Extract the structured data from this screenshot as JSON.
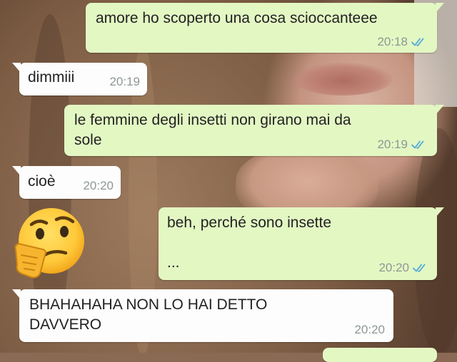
{
  "chat": {
    "messages": [
      {
        "direction": "outgoing",
        "text": "amore ho scoperto una cosa scioccanteee",
        "time": "20:18",
        "status": "read"
      },
      {
        "direction": "incoming",
        "text": "dimmiii",
        "time": "20:19"
      },
      {
        "direction": "outgoing",
        "text": "le femmine degli insetti non girano mai da\nsole",
        "time": "20:19",
        "status": "read"
      },
      {
        "direction": "incoming",
        "text": "cioè",
        "time": "20:20"
      },
      {
        "direction": "outgoing",
        "text": "beh, perché sono insette\n\n...",
        "time": "20:20",
        "status": "read"
      },
      {
        "direction": "incoming",
        "text": "BHAHAHAHA NON LO HAI DETTO\nDAVVERO",
        "time": "20:20"
      }
    ],
    "sticker": {
      "icon": "thinking-face-emoji"
    }
  },
  "colors": {
    "outgoing_bubble": "#e3f7c3",
    "incoming_bubble": "#fdfdfd",
    "read_ticks": "#4fa9d8",
    "timestamp": "#8e9892"
  }
}
